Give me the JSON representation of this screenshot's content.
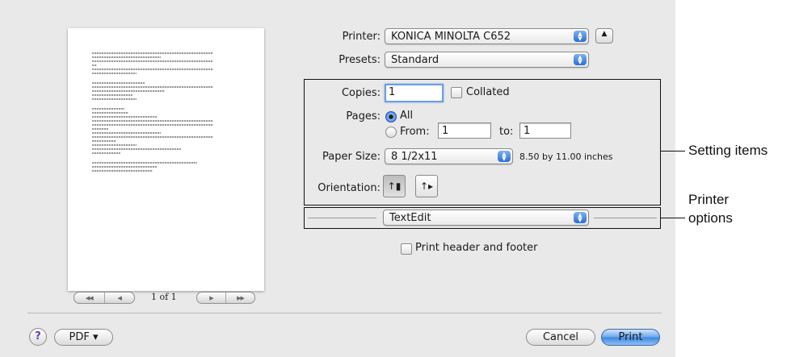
{
  "printer": {
    "label": "Printer:",
    "value": "KONICA MINOLTA C652"
  },
  "presets": {
    "label": "Presets:",
    "value": "Standard"
  },
  "copies": {
    "label": "Copies:",
    "value": "1",
    "collated_label": "Collated"
  },
  "pages": {
    "label": "Pages:",
    "all_label": "All",
    "from_label": "From:",
    "from_value": "1",
    "to_label": "to:",
    "to_value": "1"
  },
  "paper_size": {
    "label": "Paper Size:",
    "value": "8 1/2x11",
    "description": "8.50 by 11.00 inches"
  },
  "orientation": {
    "label": "Orientation:"
  },
  "app_menu": {
    "value": "TextEdit"
  },
  "header_footer": {
    "label": "Print header and footer"
  },
  "preview": {
    "page_indicator": "1 of 1"
  },
  "footer": {
    "help": "?",
    "pdf_label": "PDF ▾",
    "cancel_label": "Cancel",
    "print_label": "Print"
  },
  "annotations": {
    "setting_items": "Setting items",
    "printer_options_line1": "Printer",
    "printer_options_line2": "options"
  },
  "colors": {
    "accent": "#3d86e0",
    "dialog_bg": "#e9e9e9"
  }
}
